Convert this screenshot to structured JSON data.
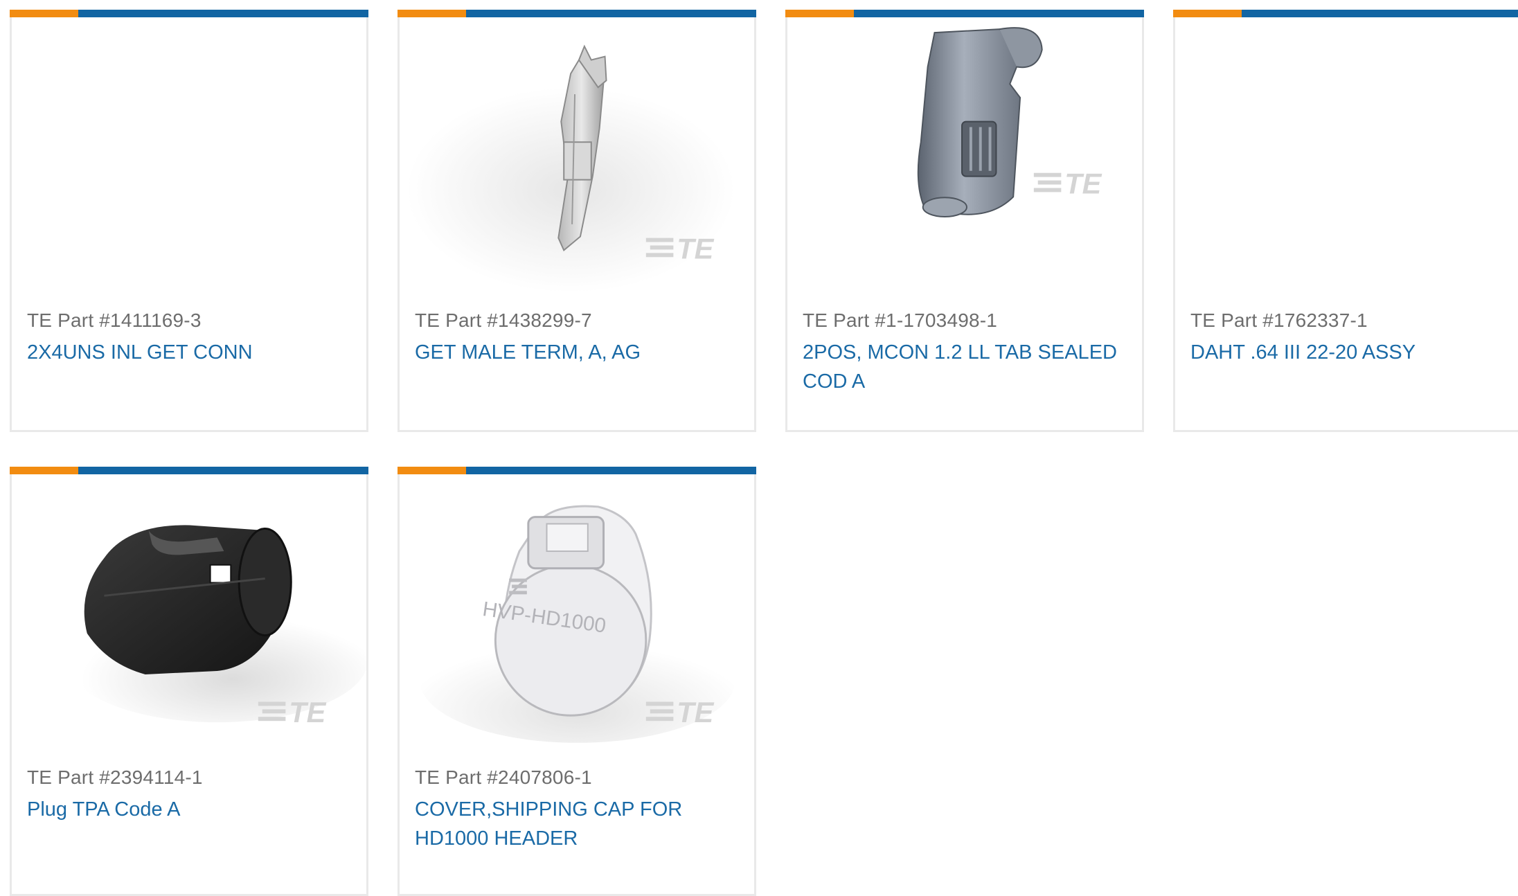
{
  "products": [
    {
      "part": "TE Part #1411169-3",
      "title": "2X4UNS INL GET CONN",
      "image": "none"
    },
    {
      "part": "TE Part #1438299-7",
      "title": "GET MALE TERM, A, AG",
      "image": "terminal-pin"
    },
    {
      "part": "TE Part #1-1703498-1",
      "title": "2POS, MCON 1.2 LL TAB SEALED COD A",
      "image": "sealed-connector"
    },
    {
      "part": "TE Part #1762337-1",
      "title": "DAHT .64 III 22-20 ASSY",
      "image": "none"
    },
    {
      "part": "TE Part #2394114-1",
      "title": "Plug TPA Code A",
      "image": "tpa-plug"
    },
    {
      "part": "TE Part #2407806-1",
      "title": "COVER,SHIPPING CAP FOR HD1000 HEADER",
      "image": "shipping-cap"
    }
  ],
  "watermark_text": "TE",
  "cap_marking": "HVP-HD1000",
  "colors": {
    "accent_orange": "#f28c11",
    "accent_blue": "#1265a3",
    "link": "#1a6aa6",
    "muted": "#6d6d6d"
  }
}
